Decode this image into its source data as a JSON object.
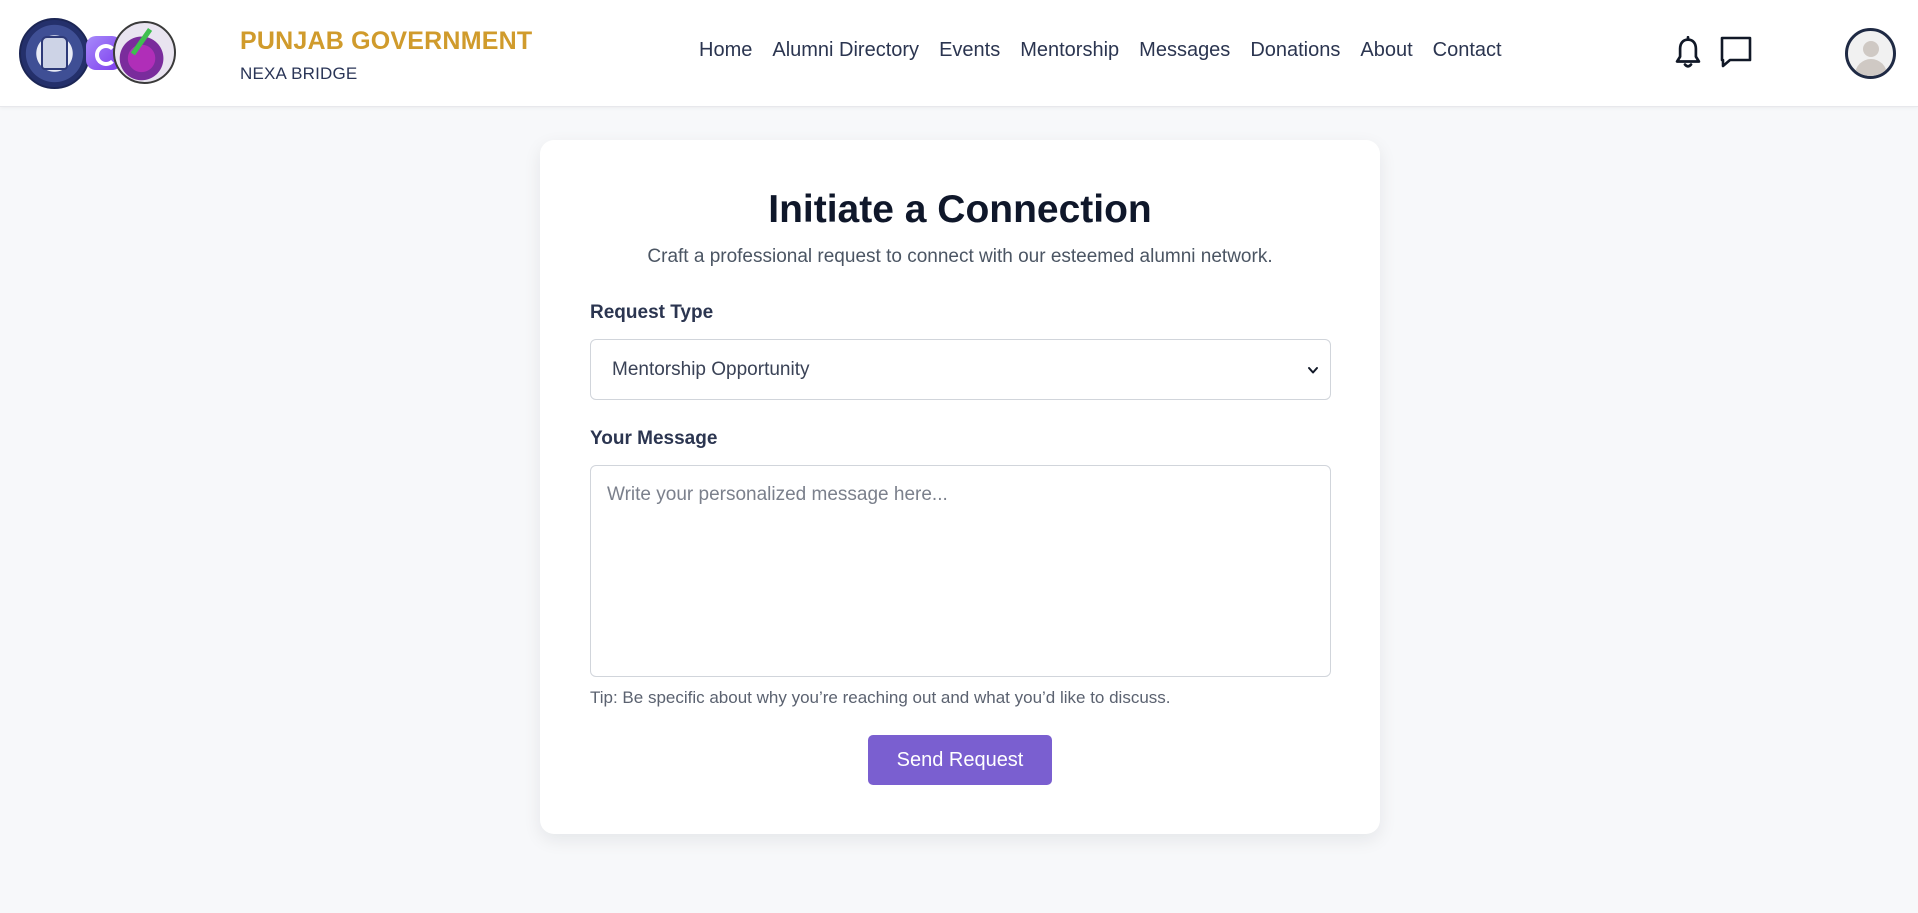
{
  "header": {
    "brand_title": "PUNJAB GOVERNMENT",
    "brand_subtitle": "NEXA BRIDGE",
    "nav": [
      {
        "label": "Home"
      },
      {
        "label": "Alumni Directory"
      },
      {
        "label": "Events"
      },
      {
        "label": "Mentorship"
      },
      {
        "label": "Messages"
      },
      {
        "label": "Donations"
      },
      {
        "label": "About"
      },
      {
        "label": "Contact"
      }
    ],
    "icons": {
      "notifications": "bell-icon",
      "messages": "chat-bubble-icon",
      "profile": "user-avatar"
    }
  },
  "form": {
    "title": "Initiate a Connection",
    "subtitle": "Craft a professional request to connect with our esteemed alumni network.",
    "request_type_label": "Request Type",
    "request_type_value": "Mentorship Opportunity",
    "message_label": "Your Message",
    "message_value": "",
    "message_placeholder": "Write your personalized message here...",
    "tip": "Tip: Be specific about why you’re reaching out and what you’d like to discuss.",
    "submit_label": "Send Request"
  },
  "colors": {
    "brand_gold": "#d09b2c",
    "primary_button": "#7a5fd0",
    "page_background": "#f7f8fa"
  }
}
